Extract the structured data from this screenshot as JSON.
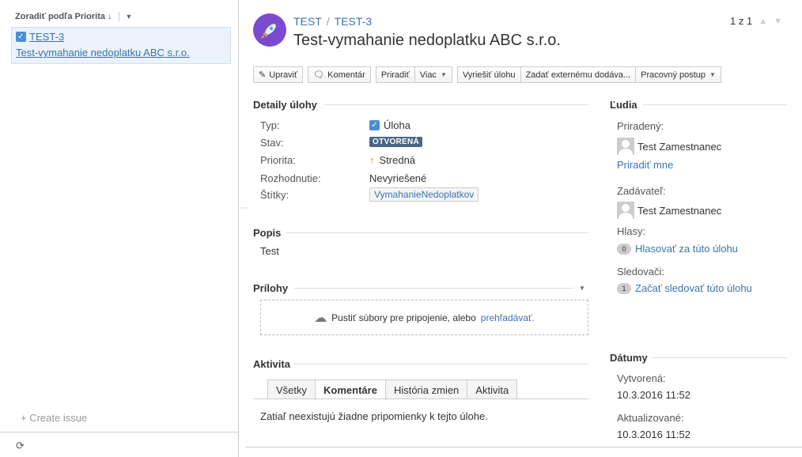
{
  "sidebar": {
    "sort_label": "Zoradiť podľa Priorita",
    "issue_key": "TEST-3",
    "issue_summary": "Test-vymahanie nedoplatku ABC s.r.o.",
    "create_issue": "+ Create issue"
  },
  "header": {
    "project": "TEST",
    "issue_key": "TEST-3",
    "title": "Test-vymahanie nedoplatku ABC s.r.o.",
    "pager": "1 z 1"
  },
  "toolbar": {
    "edit": "Upraviť",
    "comment": "Komentár",
    "assign": "Priradiť",
    "more": "Viac",
    "resolve": "Vyriešiť úlohu",
    "assign_external": "Zadať externému dodáva...",
    "workflow": "Pracovný postup"
  },
  "details": {
    "heading": "Detaily úlohy",
    "type_label": "Typ:",
    "type_value": "Úloha",
    "status_label": "Stav:",
    "status_value": "OTVORENÁ",
    "priority_label": "Priorita:",
    "priority_value": "Stredná",
    "resolution_label": "Rozhodnutie:",
    "resolution_value": "Nevyriešené",
    "labels_label": "Štítky:",
    "labels_value": "VymahanieNedoplatkov"
  },
  "description": {
    "heading": "Popis",
    "text": "Test"
  },
  "attachments": {
    "heading": "Prílohy",
    "drop_text": "Pustiť súbory pre pripojenie, alebo",
    "browse_link": "prehľadávať."
  },
  "activity": {
    "heading": "Aktivita",
    "tabs": [
      "Všetky",
      "Komentáre",
      "História zmien",
      "Aktivita"
    ],
    "empty_text": "Zatiaľ neexistujú žiadne pripomienky k tejto úlohe."
  },
  "people": {
    "heading": "Ľudia",
    "assignee_label": "Priradený:",
    "assignee_name": "Test Zamestnanec",
    "assign_to_me": "Priradiť mne",
    "reporter_label": "Zadávateľ:",
    "reporter_name": "Test Zamestnanec",
    "votes_label": "Hlasy:",
    "votes_count": "0",
    "vote_link": "Hlasovať za túto úlohu",
    "watchers_label": "Sledovači:",
    "watchers_count": "1",
    "watch_link": "Začať sledovať túto úlohu"
  },
  "dates": {
    "heading": "Dátumy",
    "created_label": "Vytvorená:",
    "created_value": "10.3.2016 11:52",
    "updated_label": "Aktualizované:",
    "updated_value": "10.3.2016 11:52"
  },
  "colors": {
    "link": "#3b73af",
    "status_lozenge": "#4a6785",
    "avatar": "#7b4bcf",
    "selected_card": "#ebf2f9"
  }
}
